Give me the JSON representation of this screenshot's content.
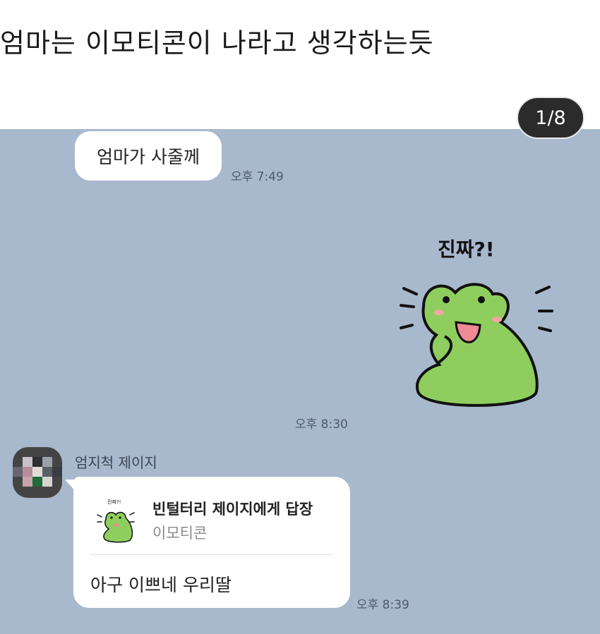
{
  "post": {
    "title": "엄마는 이모티콘이 나라고 생각하는듯",
    "image_counter": "1/8"
  },
  "chat": {
    "messages": [
      {
        "text": "엄마가 사줄께",
        "time": "오후 7:49"
      },
      {
        "sticker_caption": "진짜?!",
        "time": "오후 8:30"
      },
      {
        "sender": "엄지척 제이지",
        "reply_title": "빈털터리 제이지에게 답장",
        "reply_subtitle": "이모티콘",
        "text": "아구 이쁘네 우리딸",
        "time": "오후 8:39"
      }
    ]
  },
  "colors": {
    "chat_background": "#a8b8cd",
    "bubble": "#ffffff",
    "frog": "#8fce5e",
    "counter_bg": "#2b2b2b"
  }
}
